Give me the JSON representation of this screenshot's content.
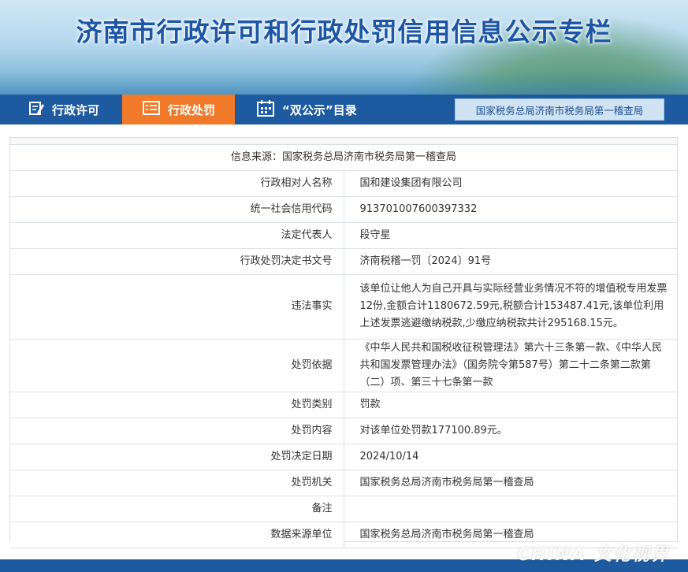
{
  "banner": {
    "title": "济南市行政许可和行政处罚信用信息公示专栏"
  },
  "nav": {
    "tabs": [
      {
        "label": "行政许可",
        "icon": "edit-icon",
        "active": false
      },
      {
        "label": "行政处罚",
        "icon": "list-icon",
        "active": true
      },
      {
        "label": "“双公示”目录",
        "icon": "calendar-icon",
        "active": false
      }
    ],
    "org_label": "国家税务总局济南市税务局第一稽查局"
  },
  "detail": {
    "source": "信息来源：国家税务总局济南市税务局第一稽查局",
    "rows": [
      {
        "label": "行政相对人名称",
        "value": "国和建设集团有限公司"
      },
      {
        "label": "统一社会信用代码",
        "value": "913701007600397332"
      },
      {
        "label": "法定代表人",
        "value": "段守星"
      },
      {
        "label": "行政处罚决定书文号",
        "value": "济南税稽一罚〔2024〕91号"
      },
      {
        "label": "违法事实",
        "value": "该单位让他人为自己开具与实际经营业务情况不符的增值税专用发票12份,金额合计1180672.59元,税额合计153487.41元,该单位利用上述发票逃避缴纳税款,少缴应纳税款共计295168.15元。"
      },
      {
        "label": "处罚依据",
        "value": "《中华人民共和国税收征税管理法》第六十三条第一款、《中华人民共和国发票管理办法》（国务院令第587号）第二十二条第二款第（二）项、第三十七条第一款"
      },
      {
        "label": "处罚类别",
        "value": "罚款"
      },
      {
        "label": "处罚内容",
        "value": "对该单位处罚款177100.89元。"
      },
      {
        "label": "处罚决定日期",
        "value": "2024/10/14"
      },
      {
        "label": "处罚机关",
        "value": "国家税务总局济南市税务局第一稽查局"
      },
      {
        "label": "备注",
        "value": ""
      },
      {
        "label": "数据来源单位",
        "value": "国家税务总局济南市税务局第一稽查局"
      }
    ]
  },
  "watermark": "CHINA 文化视界"
}
